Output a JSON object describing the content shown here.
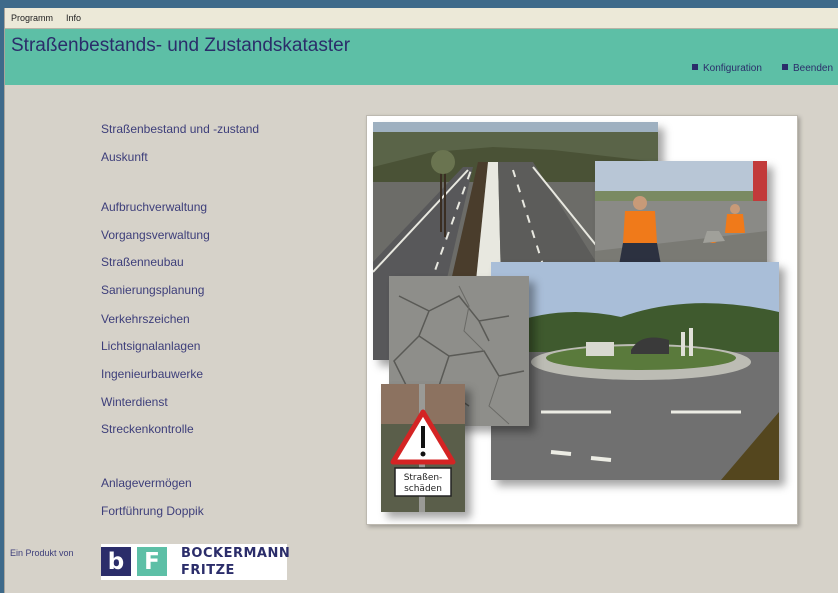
{
  "menu": {
    "items": [
      "Programm",
      "Info"
    ]
  },
  "header": {
    "title": "Straßenbestands- und Zustandskataster",
    "links": [
      "Konfiguration",
      "Beenden"
    ]
  },
  "nav": {
    "items": [
      "Straßenbestand und -zustand",
      "Auskunft",
      "Aufbruchverwaltung",
      "Vorgangsverwaltung",
      "Straßenneubau",
      "Sanierungsplanung",
      "Verkehrszeichen",
      "Lichtsignalanlagen",
      "Ingenieurbauwerke",
      "Winterdienst",
      "Streckenkontrolle",
      "Anlagevermögen",
      "Fortführung Doppik"
    ]
  },
  "photos": {
    "sign_text": [
      "Straßen-",
      "schäden"
    ]
  },
  "footer": {
    "label": "Ein Produkt von",
    "logo_letters": [
      "b",
      "F"
    ],
    "logo_text": [
      "BOCKERMANN",
      "FRITZE"
    ]
  },
  "colors": {
    "header_bg": "#5dbfa6",
    "accent": "#2b2d6a",
    "window_bg": "#d6d2c9"
  }
}
